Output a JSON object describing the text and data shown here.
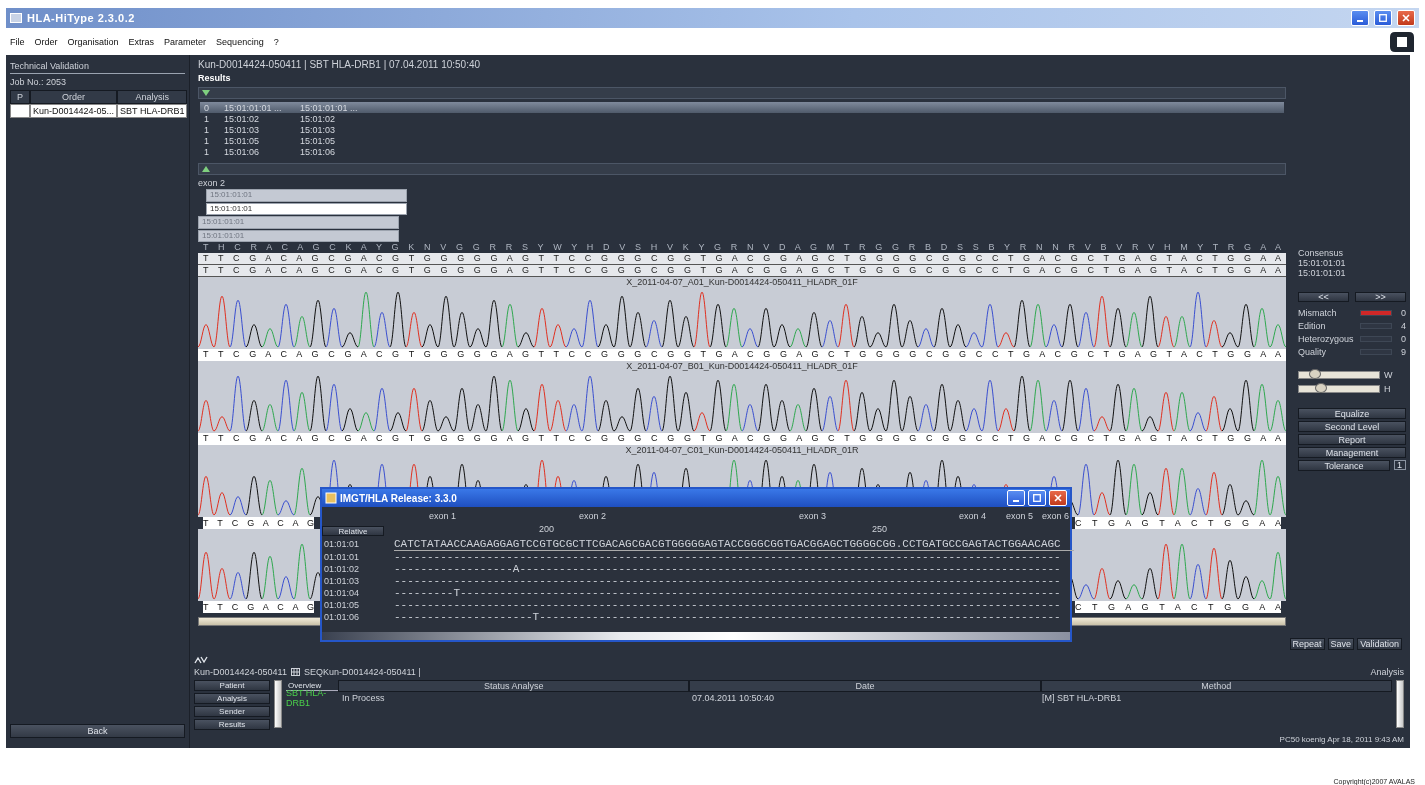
{
  "window": {
    "title": "HLA-HiType 2.3.0.2"
  },
  "menu": [
    "File",
    "Order",
    "Organisation",
    "Extras",
    "Parameter",
    "Sequencing",
    "?"
  ],
  "sidebar": {
    "title": "Technical Validation",
    "job": "Job No.: 2053",
    "columns": [
      "P",
      "Order",
      "Analysis"
    ],
    "rows": [
      {
        "order": "Kun-D0014424-05...",
        "analysis": "SBT HLA-DRB1",
        "selected": true
      }
    ],
    "back": "Back"
  },
  "header": "Kun-D0014424-050411  |  SBT HLA-DRB1  |  07.04.2011 10:50:40",
  "results": {
    "title": "Results",
    "rows": [
      {
        "count": "0",
        "allele_1": "15:01:01:01 ...",
        "allele_2": "15:01:01:01 ...",
        "selected": true
      },
      {
        "count": "1",
        "allele_1": "15:01:02",
        "allele_2": "15:01:02",
        "selected": false
      },
      {
        "count": "1",
        "allele_1": "15:01:03",
        "allele_2": "15:01:03",
        "selected": false
      },
      {
        "count": "1",
        "allele_1": "15:01:05",
        "allele_2": "15:01:05",
        "selected": false
      },
      {
        "count": "1",
        "allele_1": "15:01:06",
        "allele_2": "15:01:06",
        "selected": false
      }
    ]
  },
  "exon": {
    "label": "exon 2",
    "bars": [
      {
        "text": "15:01:01:01",
        "kind": "indented",
        "selected": false
      },
      {
        "text": "15:01:01:01",
        "kind": "indented",
        "selected": true
      },
      {
        "text": "15:01:01:01",
        "kind": "flush",
        "selected": false
      },
      {
        "text": "15:01:01:01",
        "kind": "flush",
        "selected": false
      }
    ]
  },
  "sequence": {
    "amino": "T H C R A C A G C K A Y G K N V G G R R S Y W Y H D V S H V K Y G R N V D A G M T R G G R B D S S B Y R N N R V B V R V H M Y T R G A A",
    "consensus": [
      "T T C G A C A G C G A C G T G G G G G A G T T C C G G G C G G T G A C G G A G C T G G G G C G G C C T G A C G C T G A G T A C T G G A A",
      "T T C G A C A G C G A C G T G G G G G A G T T C C G G G C G G T G A C G G A G C T G G G G C G G C C T G A C G C T G A G T A C T G G A A"
    ]
  },
  "traces": [
    {
      "label": "X_2011-04-07_A01_Kun-D0014424-050411_HLADR_01F",
      "bases": "T T C G A C A G C G A C G T G G G G G A G T T C C G G G C G G T G A C G G A G C T G G G G C G G C C T G A C G C T G A G T A C T G G A A"
    },
    {
      "label": "X_2011-04-07_B01_Kun-D0014424-050411_HLADR_01F",
      "bases": "T T C G A C A G C G A C G T G G G G G A G T T C C G G G C G G T G A C G G A G C T G G G G C G G C C T G A C G C T G A G T A C T G G A A"
    },
    {
      "label": "X_2011-04-07_C01_Kun-D0014424-050411_HLADR_01R",
      "bases_start": "T T C G A C A G",
      "bases_end": "C T G A G T A C T G G A A"
    },
    {
      "bases_start": "T T C G A C A G",
      "bases_end": "C T G A G T A C T G G A A"
    }
  ],
  "consensus_panel": {
    "title": "Consensus",
    "alleles": [
      "15:01:01:01",
      "15:01:01:01"
    ]
  },
  "nav": [
    "<<",
    ">>"
  ],
  "stats": [
    {
      "label": "Mismatch",
      "value": "0",
      "level": 1
    },
    {
      "label": "Edition",
      "value": "4",
      "level": 0
    },
    {
      "label": "Heterozygous",
      "value": "0",
      "level": 0
    },
    {
      "label": "Quality",
      "value": "9",
      "level": 0
    }
  ],
  "sliders": [
    {
      "label": "W",
      "level": 0.2
    },
    {
      "label": "H",
      "level": 0.27
    }
  ],
  "actions": [
    "Equalize",
    "Second Level",
    "Report",
    "Management"
  ],
  "tolerance": {
    "label": "Tolerance",
    "value": "1"
  },
  "footer_buttons": [
    "Repeat",
    "Save",
    "Validation"
  ],
  "dialog": {
    "title": "IMGT/HLA Release: 3.3.0",
    "exons": [
      "exon 1",
      "exon 2",
      "exon 3",
      "exon 4",
      "exon 5",
      "exon 6"
    ],
    "ruler": [
      "200",
      "250"
    ],
    "relative": "Relative",
    "reference": {
      "name": "01:01:01",
      "seq": "CATCTATAACCAAGAGGAGTCCGTGCGCTTCGACAGCGACGTGGGGGAGTACCGGGCGGTGACGGAGCTGGGGCGG.CCTGATGCCGAGTACTGGAACAGC"
    },
    "alleles": [
      {
        "name": "01:01:01",
        "seq": "-----------------------------------------------------------------------------------------------------"
      },
      {
        "name": "01:01:02",
        "seq": "------------------A----------------------------------------------------------------------------------"
      },
      {
        "name": "01:01:03",
        "seq": "-----------------------------------------------------------------------------------------------------"
      },
      {
        "name": "01:01:04",
        "seq": "---------T-------------------------------------------------------------------------------------------"
      },
      {
        "name": "01:01:05",
        "seq": "-----------------------------------------------------------------------------------------------------"
      },
      {
        "name": "01:01:06",
        "seq": "---------------------T-------------------------------------------------------------------------------"
      }
    ]
  },
  "bottom": {
    "ids": [
      "Kun-D0014424-050411",
      "SEQKun-D0014424-050411 |"
    ],
    "analysis": "Analysis",
    "tabs": [
      "Patient",
      "Analysis",
      "Sender",
      "Results"
    ],
    "overview": "Overview",
    "columns": [
      "Status Analyse",
      "Date",
      "Method"
    ],
    "row": {
      "name": "SBT HLA-DRB1",
      "status": "In Process",
      "date": "07.04.2011 10:50:40",
      "method": "[M] SBT HLA-DRB1"
    }
  },
  "status": "PC50  koenig  Apr 18, 2011 9:43 AM",
  "copyright": "Copyright(c)2007 AVALAS"
}
